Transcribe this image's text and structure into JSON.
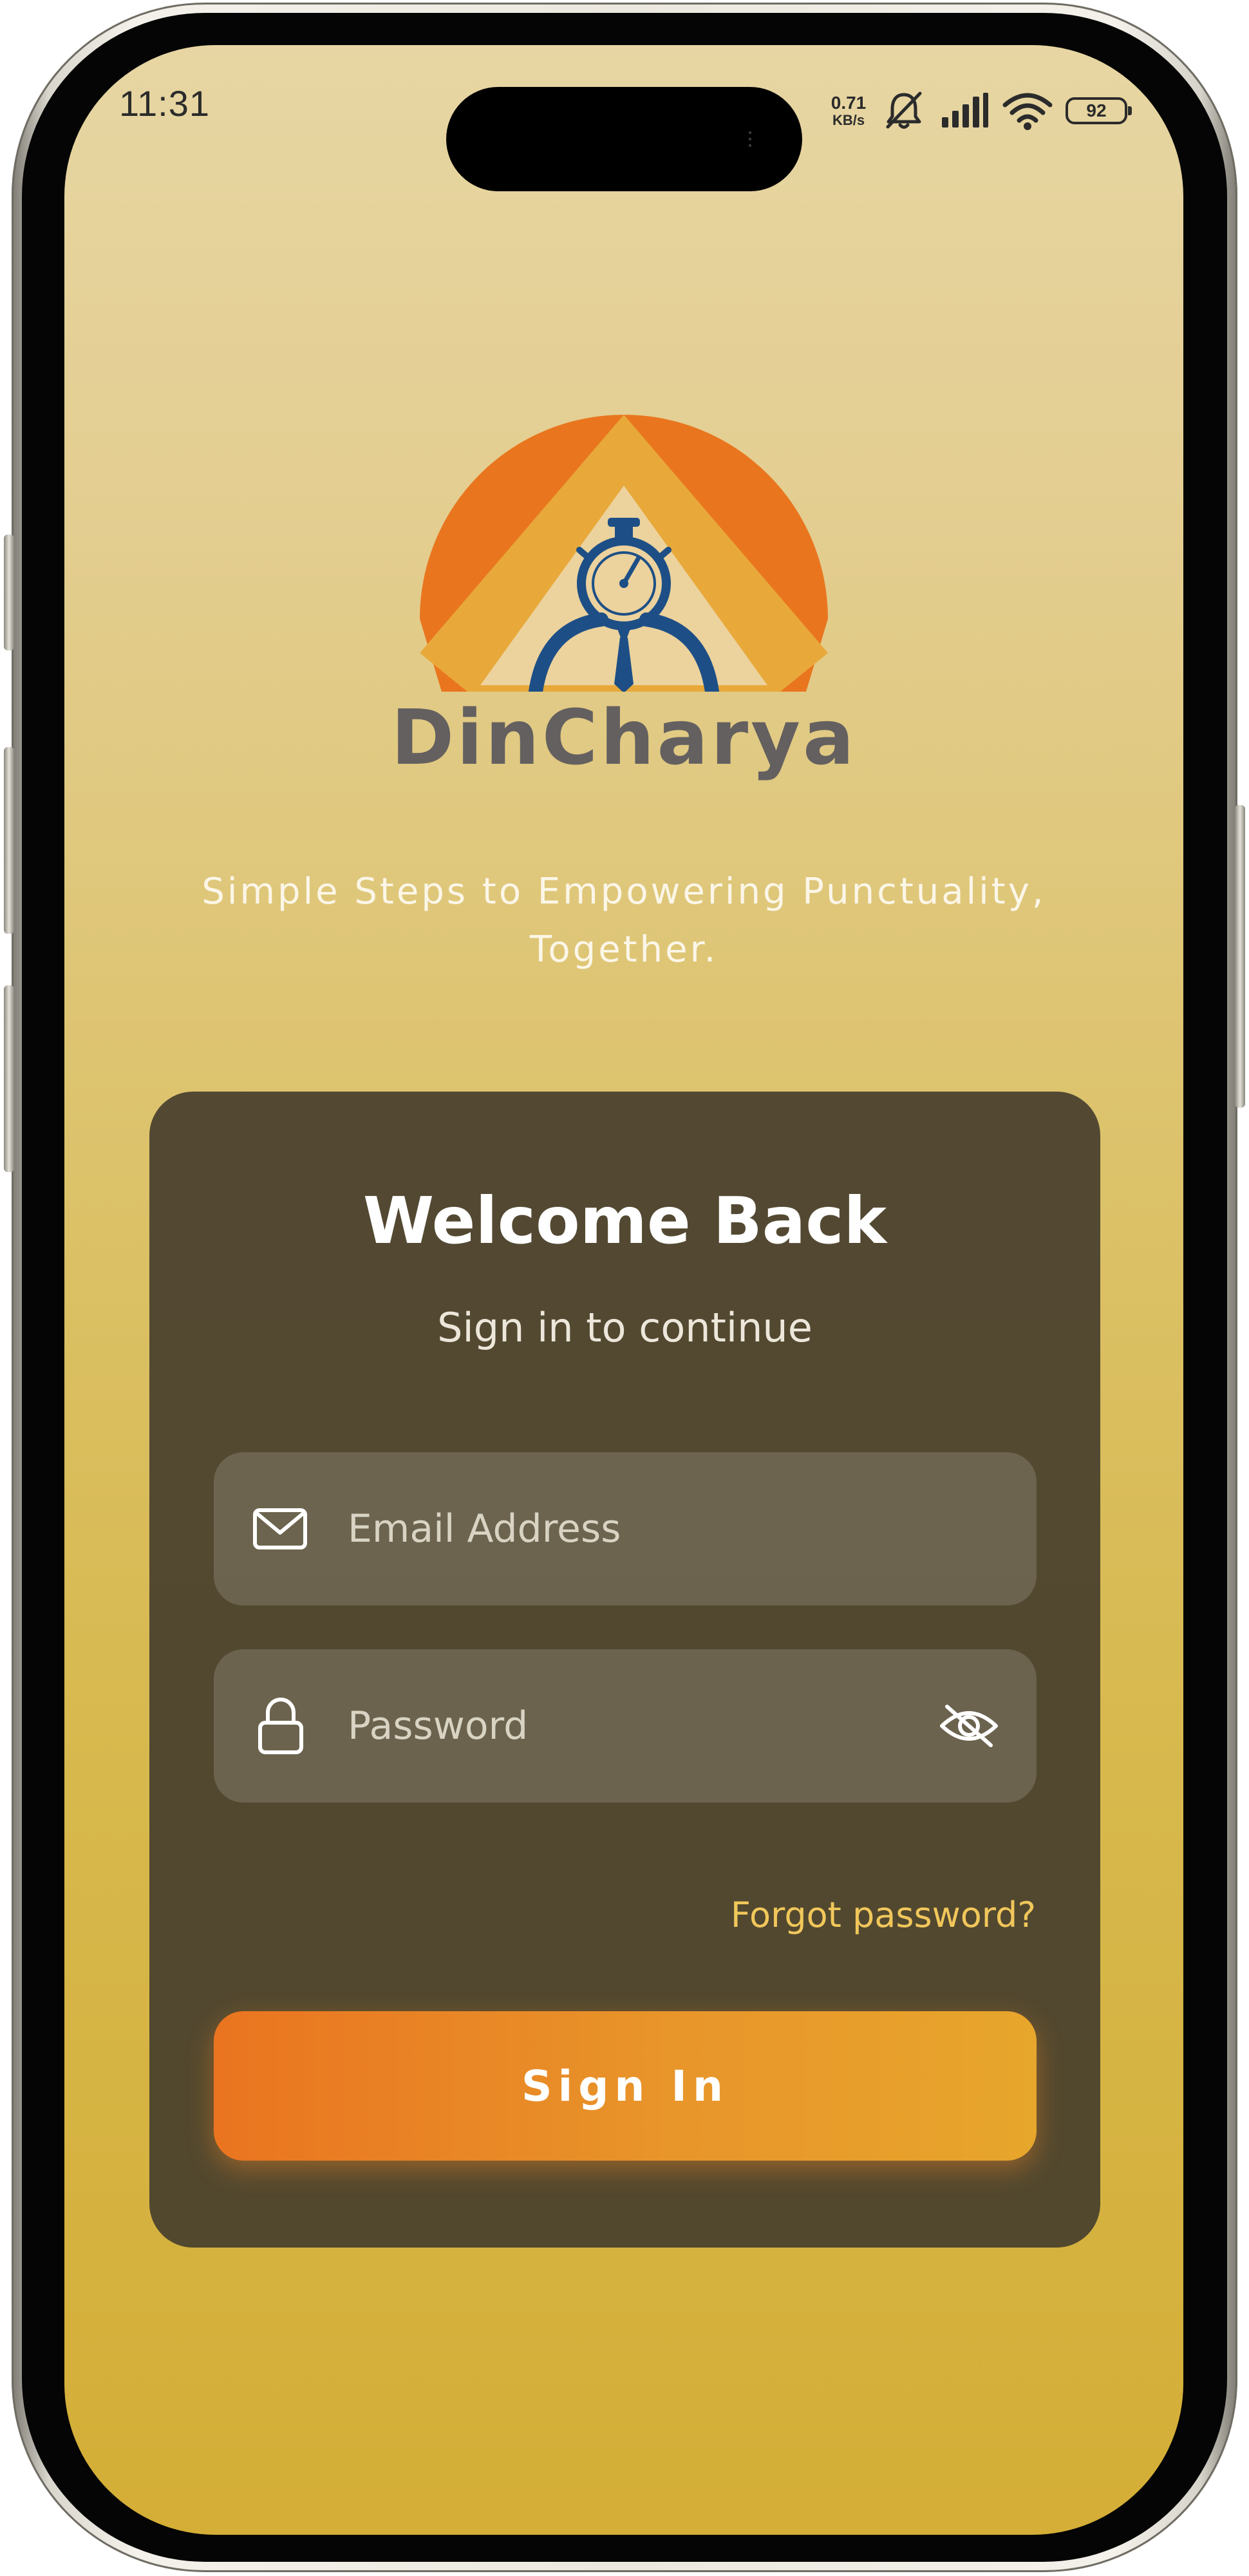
{
  "status_bar": {
    "time": "11:31",
    "net_speed_value": "0.71",
    "net_speed_unit": "KB/s",
    "battery_level": "92",
    "icons": [
      "bell-muted-icon",
      "signal-icon",
      "wifi-icon",
      "battery-icon"
    ]
  },
  "branding": {
    "app_name": "DinCharya",
    "tagline_line1": "Simple Steps to Empowering Punctuality,",
    "tagline_line2": "Together.",
    "logo_icon": "stopwatch-person-logo",
    "colors": {
      "orange_dark": "#e9761f",
      "orange_light": "#e8a93a",
      "navy": "#1d4f86",
      "gray_text": "#646060"
    }
  },
  "login_card": {
    "title": "Welcome Back",
    "subtitle": "Sign in to continue",
    "email": {
      "placeholder": "Email Address",
      "value": "",
      "icon": "mail-icon"
    },
    "password": {
      "placeholder": "Password",
      "value": "",
      "icon": "lock-icon",
      "toggle_icon": "eye-off-icon"
    },
    "forgot_password": "Forgot password?",
    "sign_in_label": "Sign In",
    "colors": {
      "card_bg": "#4c4433",
      "accent": "#f1c75b",
      "button_start": "#ea7420",
      "button_end": "#e7a62c"
    }
  }
}
